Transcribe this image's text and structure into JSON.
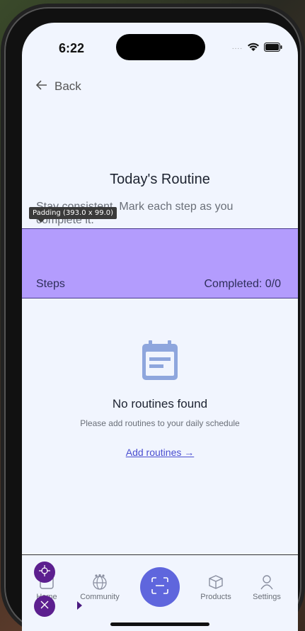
{
  "status": {
    "time": "6:22",
    "dots": "...."
  },
  "header": {
    "back_label": "Back"
  },
  "page": {
    "title": "Today's Routine",
    "subtitle": "Stay consistent. Mark each step as you complete it."
  },
  "debug": {
    "tooltip": "Padding (393.0 x 99.0)"
  },
  "steps": {
    "label": "Steps",
    "completed": "Completed: 0/0"
  },
  "empty": {
    "title": "No routines found",
    "description": "Please add routines to your daily schedule",
    "link": "Add routines →"
  },
  "nav": {
    "items": [
      {
        "label": "Home",
        "icon": "home-icon"
      },
      {
        "label": "Community",
        "icon": "globe-icon"
      },
      {
        "label": "",
        "icon": "scan-icon"
      },
      {
        "label": "Products",
        "icon": "box-icon"
      },
      {
        "label": "Settings",
        "icon": "user-icon"
      }
    ]
  },
  "colors": {
    "background": "#f1f5fe",
    "accent": "#5f66dd",
    "highlight": "#b39cfd",
    "fab": "#5c1f8f"
  }
}
